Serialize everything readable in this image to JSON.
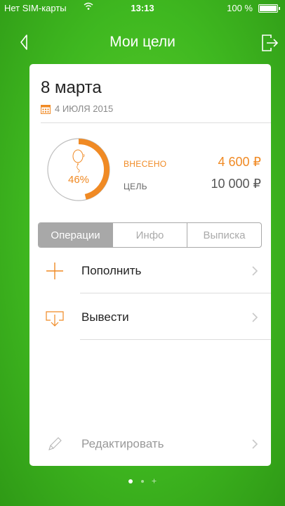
{
  "status_bar": {
    "carrier": "Нет SIM-карты",
    "time": "13:13",
    "battery": "100 %"
  },
  "nav": {
    "title": "Мои цели"
  },
  "goal": {
    "title": "8 марта",
    "date": "4 ИЮЛЯ 2015",
    "progress_percent": 46,
    "progress_label": "46%",
    "deposited_label": "ВНЕСЕНО",
    "deposited_value": "4 600 ₽",
    "target_label": "ЦЕЛЬ",
    "target_value": "10 000 ₽"
  },
  "tabs": [
    {
      "label": "Операции",
      "active": true
    },
    {
      "label": "Инфо",
      "active": false
    },
    {
      "label": "Выписка",
      "active": false
    }
  ],
  "actions": {
    "top_up": "Пополнить",
    "withdraw": "Вывести",
    "edit": "Редактировать"
  },
  "pager": {
    "pages": 3,
    "current": 1
  },
  "colors": {
    "accent": "#f08a24",
    "background": "#3fb820",
    "segment_active": "#a8a8a8"
  }
}
